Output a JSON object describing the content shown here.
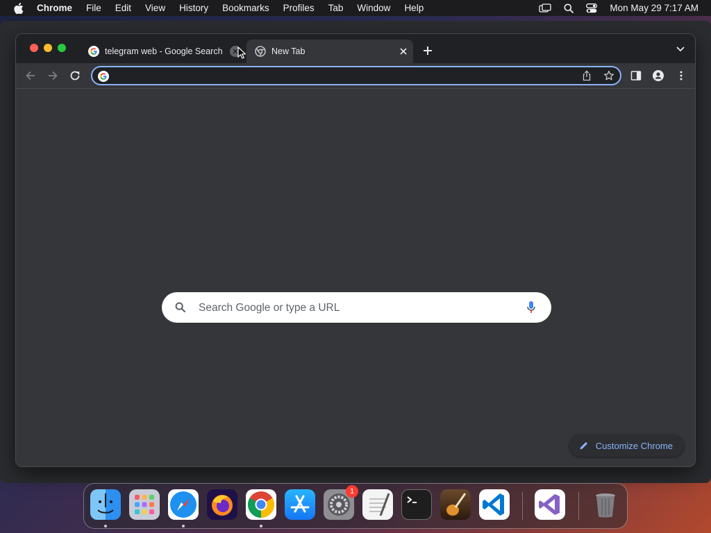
{
  "menubar": {
    "app_name": "Chrome",
    "items": [
      "File",
      "Edit",
      "View",
      "History",
      "Bookmarks",
      "Profiles",
      "Tab",
      "Window",
      "Help"
    ],
    "clock": "Mon May 29  7:17 AM"
  },
  "tabs": [
    {
      "title": "telegram web - Google Search",
      "favicon": "google-g-icon",
      "active": false
    },
    {
      "title": "New Tab",
      "favicon": "chrome-icon",
      "active": true
    }
  ],
  "omnibox": {
    "value": "",
    "placeholder": ""
  },
  "ntp": {
    "search_placeholder": "Search Google or type a URL",
    "customize_label": "Customize Chrome"
  },
  "dock": {
    "apps": [
      "finder-icon",
      "launchpad-icon",
      "safari-icon",
      "firefox-icon",
      "chrome-icon",
      "app-store-icon",
      "system-settings-icon",
      "textedit-icon",
      "terminal-icon",
      "garageband-icon",
      "vscode-icon",
      "visual-studio-icon",
      "trash-icon"
    ],
    "settings_badge": "1"
  },
  "colors": {
    "tabstrip": "#202124",
    "toolbar": "#35363a",
    "accent": "#8ab4f8",
    "badge": "#ff3b30"
  }
}
